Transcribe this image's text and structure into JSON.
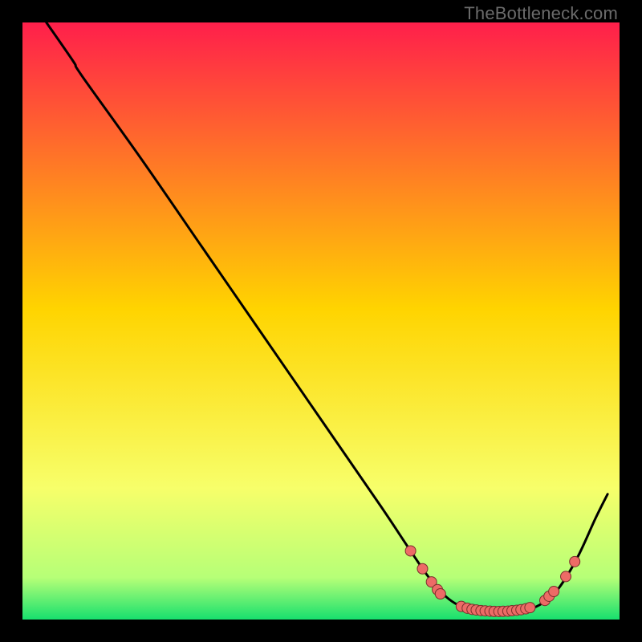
{
  "watermark": "TheBottleneck.com",
  "colors": {
    "curve": "#000000",
    "dot_fill": "#ed6b66",
    "dot_stroke": "#7a2f2c",
    "grad_top": "#ff1f4b",
    "grad_mid": "#ffd400",
    "grad_low": "#f7ff6a",
    "grad_green_light": "#b6ff77",
    "grad_green": "#17e06e"
  },
  "chart_data": {
    "type": "line",
    "title": "",
    "xlabel": "",
    "ylabel": "",
    "xlim": [
      0,
      100
    ],
    "ylim": [
      0,
      100
    ],
    "curve": [
      {
        "x": 4.0,
        "y": 100.0
      },
      {
        "x": 8.5,
        "y": 93.5
      },
      {
        "x": 10.0,
        "y": 91.0
      },
      {
        "x": 20.0,
        "y": 77.0
      },
      {
        "x": 30.0,
        "y": 62.5
      },
      {
        "x": 40.0,
        "y": 48.0
      },
      {
        "x": 50.0,
        "y": 33.5
      },
      {
        "x": 60.0,
        "y": 19.0
      },
      {
        "x": 65.0,
        "y": 11.5
      },
      {
        "x": 68.5,
        "y": 6.5
      },
      {
        "x": 72.0,
        "y": 3.0
      },
      {
        "x": 76.0,
        "y": 1.4
      },
      {
        "x": 80.0,
        "y": 1.2
      },
      {
        "x": 84.0,
        "y": 1.4
      },
      {
        "x": 87.5,
        "y": 3.0
      },
      {
        "x": 90.0,
        "y": 5.5
      },
      {
        "x": 93.0,
        "y": 10.5
      },
      {
        "x": 96.0,
        "y": 17.0
      },
      {
        "x": 98.0,
        "y": 21.0
      }
    ],
    "dots": [
      {
        "x": 65.0,
        "y": 11.5
      },
      {
        "x": 67.0,
        "y": 8.5
      },
      {
        "x": 68.5,
        "y": 6.3
      },
      {
        "x": 69.5,
        "y": 5.0
      },
      {
        "x": 70.0,
        "y": 4.3
      },
      {
        "x": 73.5,
        "y": 2.2
      },
      {
        "x": 74.5,
        "y": 1.9
      },
      {
        "x": 75.3,
        "y": 1.7
      },
      {
        "x": 76.0,
        "y": 1.6
      },
      {
        "x": 76.8,
        "y": 1.5
      },
      {
        "x": 77.5,
        "y": 1.45
      },
      {
        "x": 78.3,
        "y": 1.4
      },
      {
        "x": 79.0,
        "y": 1.36
      },
      {
        "x": 79.8,
        "y": 1.35
      },
      {
        "x": 80.5,
        "y": 1.37
      },
      {
        "x": 81.3,
        "y": 1.4
      },
      {
        "x": 82.0,
        "y": 1.47
      },
      {
        "x": 82.8,
        "y": 1.55
      },
      {
        "x": 83.5,
        "y": 1.65
      },
      {
        "x": 84.3,
        "y": 1.8
      },
      {
        "x": 85.0,
        "y": 2.0
      },
      {
        "x": 87.5,
        "y": 3.2
      },
      {
        "x": 88.2,
        "y": 3.9
      },
      {
        "x": 89.0,
        "y": 4.7
      },
      {
        "x": 91.0,
        "y": 7.2
      },
      {
        "x": 92.5,
        "y": 9.7
      }
    ]
  }
}
